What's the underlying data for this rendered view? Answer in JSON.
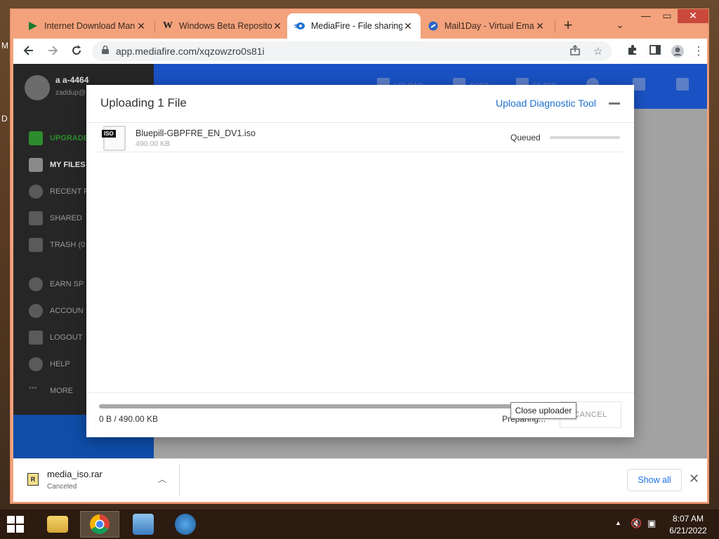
{
  "desktop": {
    "label_m": "M",
    "label_d": "D"
  },
  "tabs": [
    {
      "title": "Internet Download Man",
      "icon": "idm-play-icon"
    },
    {
      "title": "Windows Beta Reposito",
      "icon": "w-logo-icon"
    },
    {
      "title": "MediaFire - File sharing",
      "icon": "mediafire-icon",
      "active": true
    },
    {
      "title": "Mail1Day - Virtual Ema",
      "icon": "mail1day-icon"
    }
  ],
  "toolbar": {
    "url": "app.mediafire.com/xqzowzro0s81i"
  },
  "sidebar": {
    "user_name": "a a-4464",
    "user_email": "zaddup@",
    "items": [
      {
        "label": "UPGRADE"
      },
      {
        "label": "MY FILES"
      },
      {
        "label": "RECENT F"
      },
      {
        "label": "SHARED"
      },
      {
        "label": "TRASH (0"
      },
      {
        "label": "EARN SP"
      },
      {
        "label": "ACCOUN"
      },
      {
        "label": "LOGOUT"
      },
      {
        "label": "HELP"
      },
      {
        "label": "MORE"
      }
    ]
  },
  "header": {
    "upload": "UPLOAD",
    "sort": "SORT",
    "filter": "FILTER"
  },
  "uploader": {
    "title": "Uploading 1 File",
    "diagnostic_link": "Upload Diagnostic Tool",
    "file": {
      "badge": "ISO",
      "name": "Bluepill-GBPFRE_EN_DV1.iso",
      "size": "490.00 KB",
      "status": "Queued",
      "progress": 0
    },
    "total": "0 B / 490.00 KB",
    "total_progress": 0,
    "state": "Preparing...",
    "cancel": "CANCEL",
    "tooltip": "Close uploader"
  },
  "downloads": {
    "file_name": "media_iso.rar",
    "status": "Canceled",
    "show_all": "Show all"
  },
  "taskbar": {
    "time": "8:07 AM",
    "date": "6/21/2022"
  }
}
